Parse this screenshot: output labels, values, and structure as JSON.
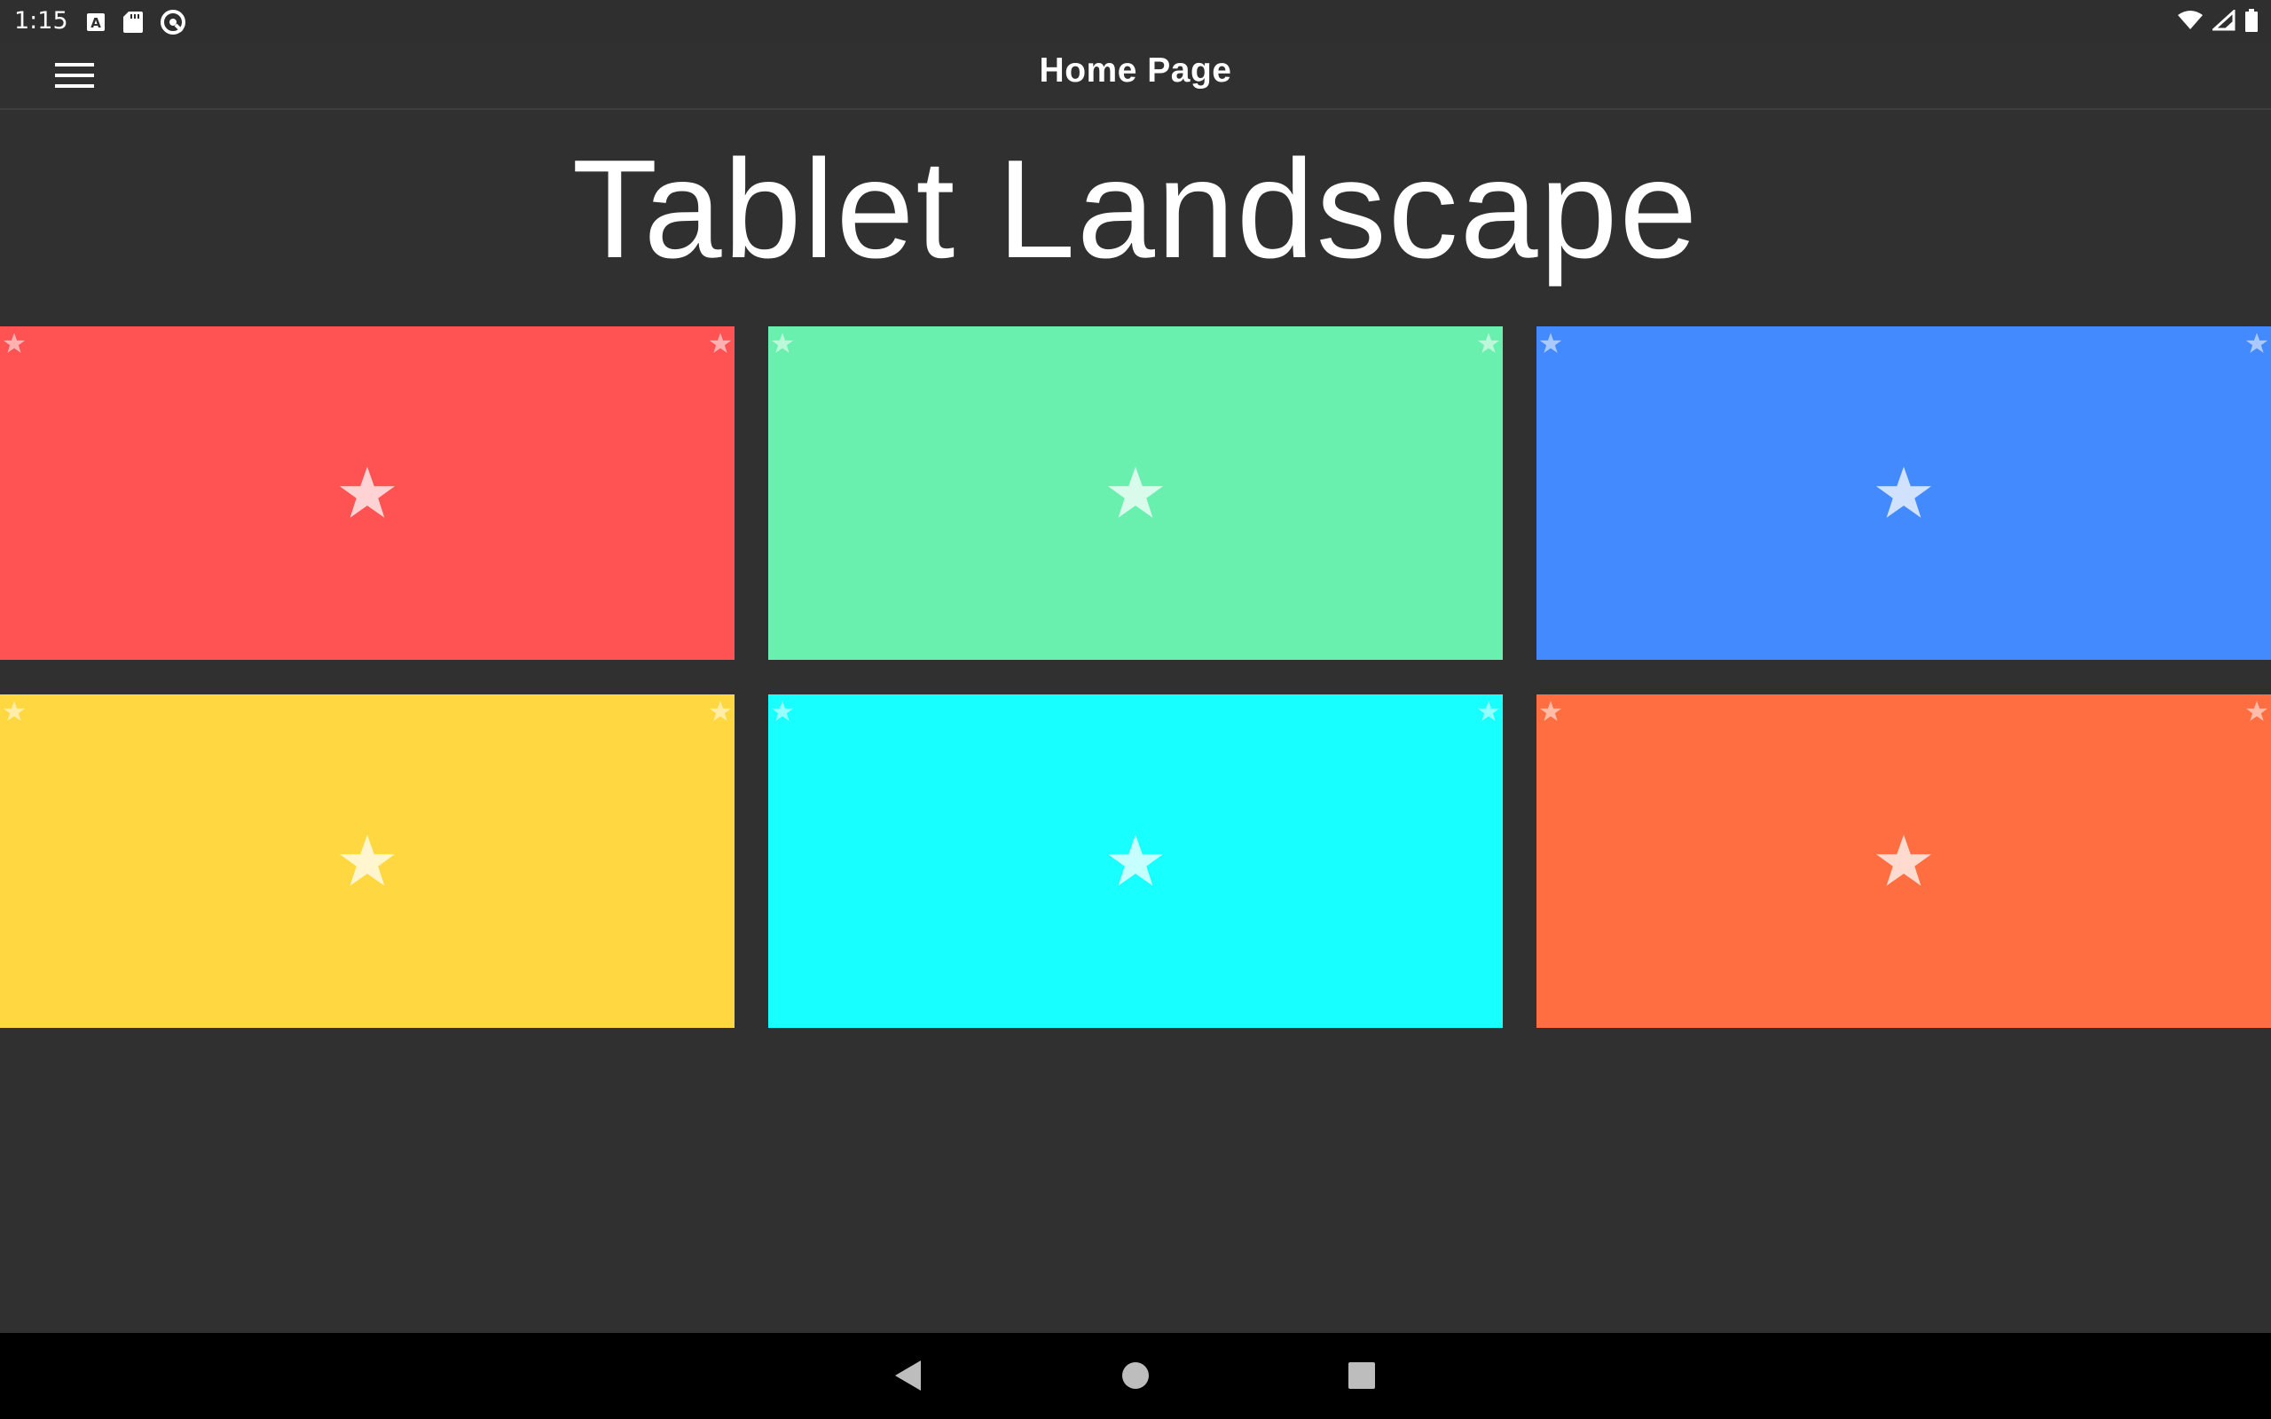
{
  "status_bar": {
    "time": "1:15",
    "left_icons": [
      "keyboard-a-icon",
      "sd-card-icon",
      "data-saver-icon"
    ],
    "right_icons": [
      "wifi-icon",
      "cell-signal-icon",
      "battery-icon"
    ]
  },
  "app_bar": {
    "title": "Home Page",
    "menu_icon": "hamburger-menu-icon"
  },
  "main": {
    "headline": "Tablet Landscape",
    "tiles": [
      {
        "color": "#ff5252"
      },
      {
        "color": "#69f0ae"
      },
      {
        "color": "#448aff"
      },
      {
        "color": "#ffd740"
      },
      {
        "color": "#18ffff"
      },
      {
        "color": "#ff6e40"
      }
    ],
    "tile_icon": "star-icon"
  },
  "nav_bar": {
    "buttons": [
      "back-icon",
      "home-icon",
      "recents-icon"
    ]
  }
}
